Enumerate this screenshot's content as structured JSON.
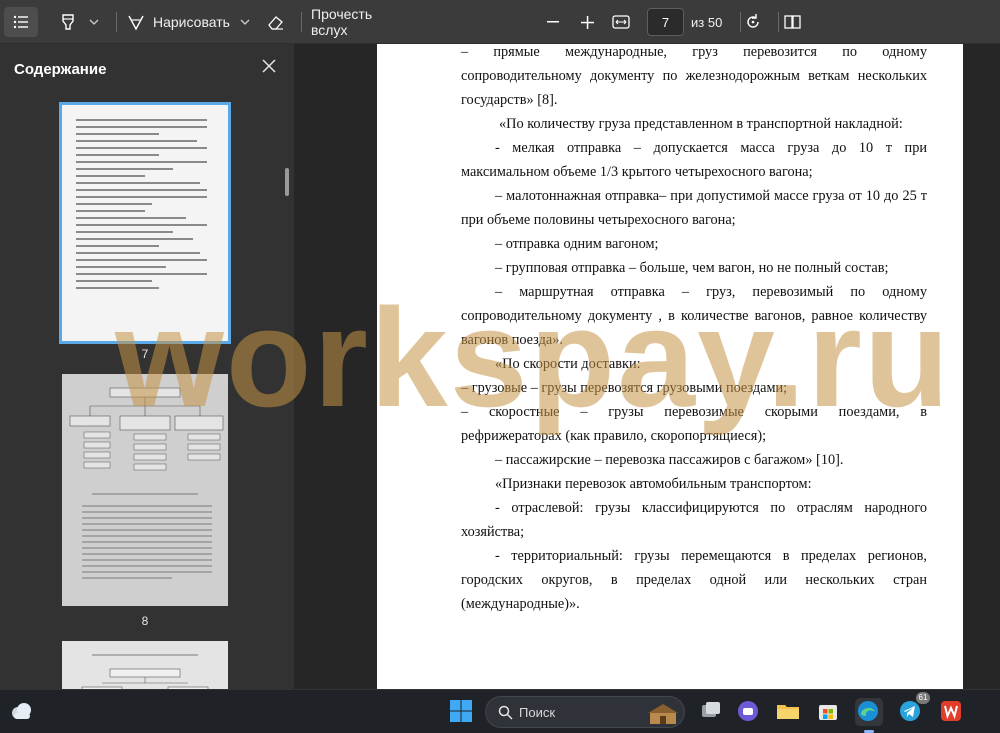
{
  "toolbar": {
    "draw_label": "Нарисовать",
    "read_aloud_label": "Прочесть вслух",
    "page_current": "7",
    "page_total_label": "из 50"
  },
  "sidebar": {
    "title": "Содержание",
    "thumbnails": [
      {
        "label": "7",
        "selected": true
      },
      {
        "label": "8",
        "selected": false
      },
      {
        "label": "",
        "selected": false
      }
    ]
  },
  "document": {
    "lines": [
      "–  прямые  международные,  груз  перевозится  по  одному",
      "сопроводительному документу по железнодорожным веткам нескольких",
      "государств» [8].",
      "«По количеству груза представленном в транспортной накладной:",
      "-  мелкая  отправка  –  допускается  масса  груза  до  10  т  при",
      "максимальном  объеме 1/3 крытого четырехосного вагона;",
      "– малотоннажная  отправка– при допустимой массе груза  от 10 до 25 т",
      "при объеме половины четырехосного вагона;",
      "–  отправка одним вагоном;",
      "– групповая отправка  – больше, чем вагон, но не полный состав;",
      "–  маршрутная  отправка  –  груз,  перевозимый  по  одному",
      "сопроводительному  документу  ,  в  количестве  вагонов,  равное  количеству",
      "вагонов поезда».",
      "«По скорости доставки:",
      "– грузовые – грузы перевозятся  грузовыми поездами;",
      "–  скоростные  –  грузы  перевозимые  скорыми  поездами,  в",
      "рефрижераторах (как правило, скоропортящиеся);",
      "– пассажирские – перевозка пассажиров с багажом» [10].",
      "«Признаки перевозок автомобильным транспортом:",
      "-  отраслевой:  грузы  классифицируются  по  отраслям  народного",
      "хозяйства;",
      "-  территориальный:  грузы  перемещаются  в  пределах  регионов,",
      "городских  округов,  в  пределах  одной  или  нескольких  стран",
      "(международные)»."
    ]
  },
  "watermark": {
    "text": "workspay.ru",
    "color": "#c49446"
  },
  "taskbar": {
    "search_label": "Поиск",
    "telegram_badge": "61"
  },
  "colors": {
    "accent": "#5aa8e6",
    "toolbar_bg": "#3b3b3b",
    "sidebar_bg": "#323232"
  }
}
